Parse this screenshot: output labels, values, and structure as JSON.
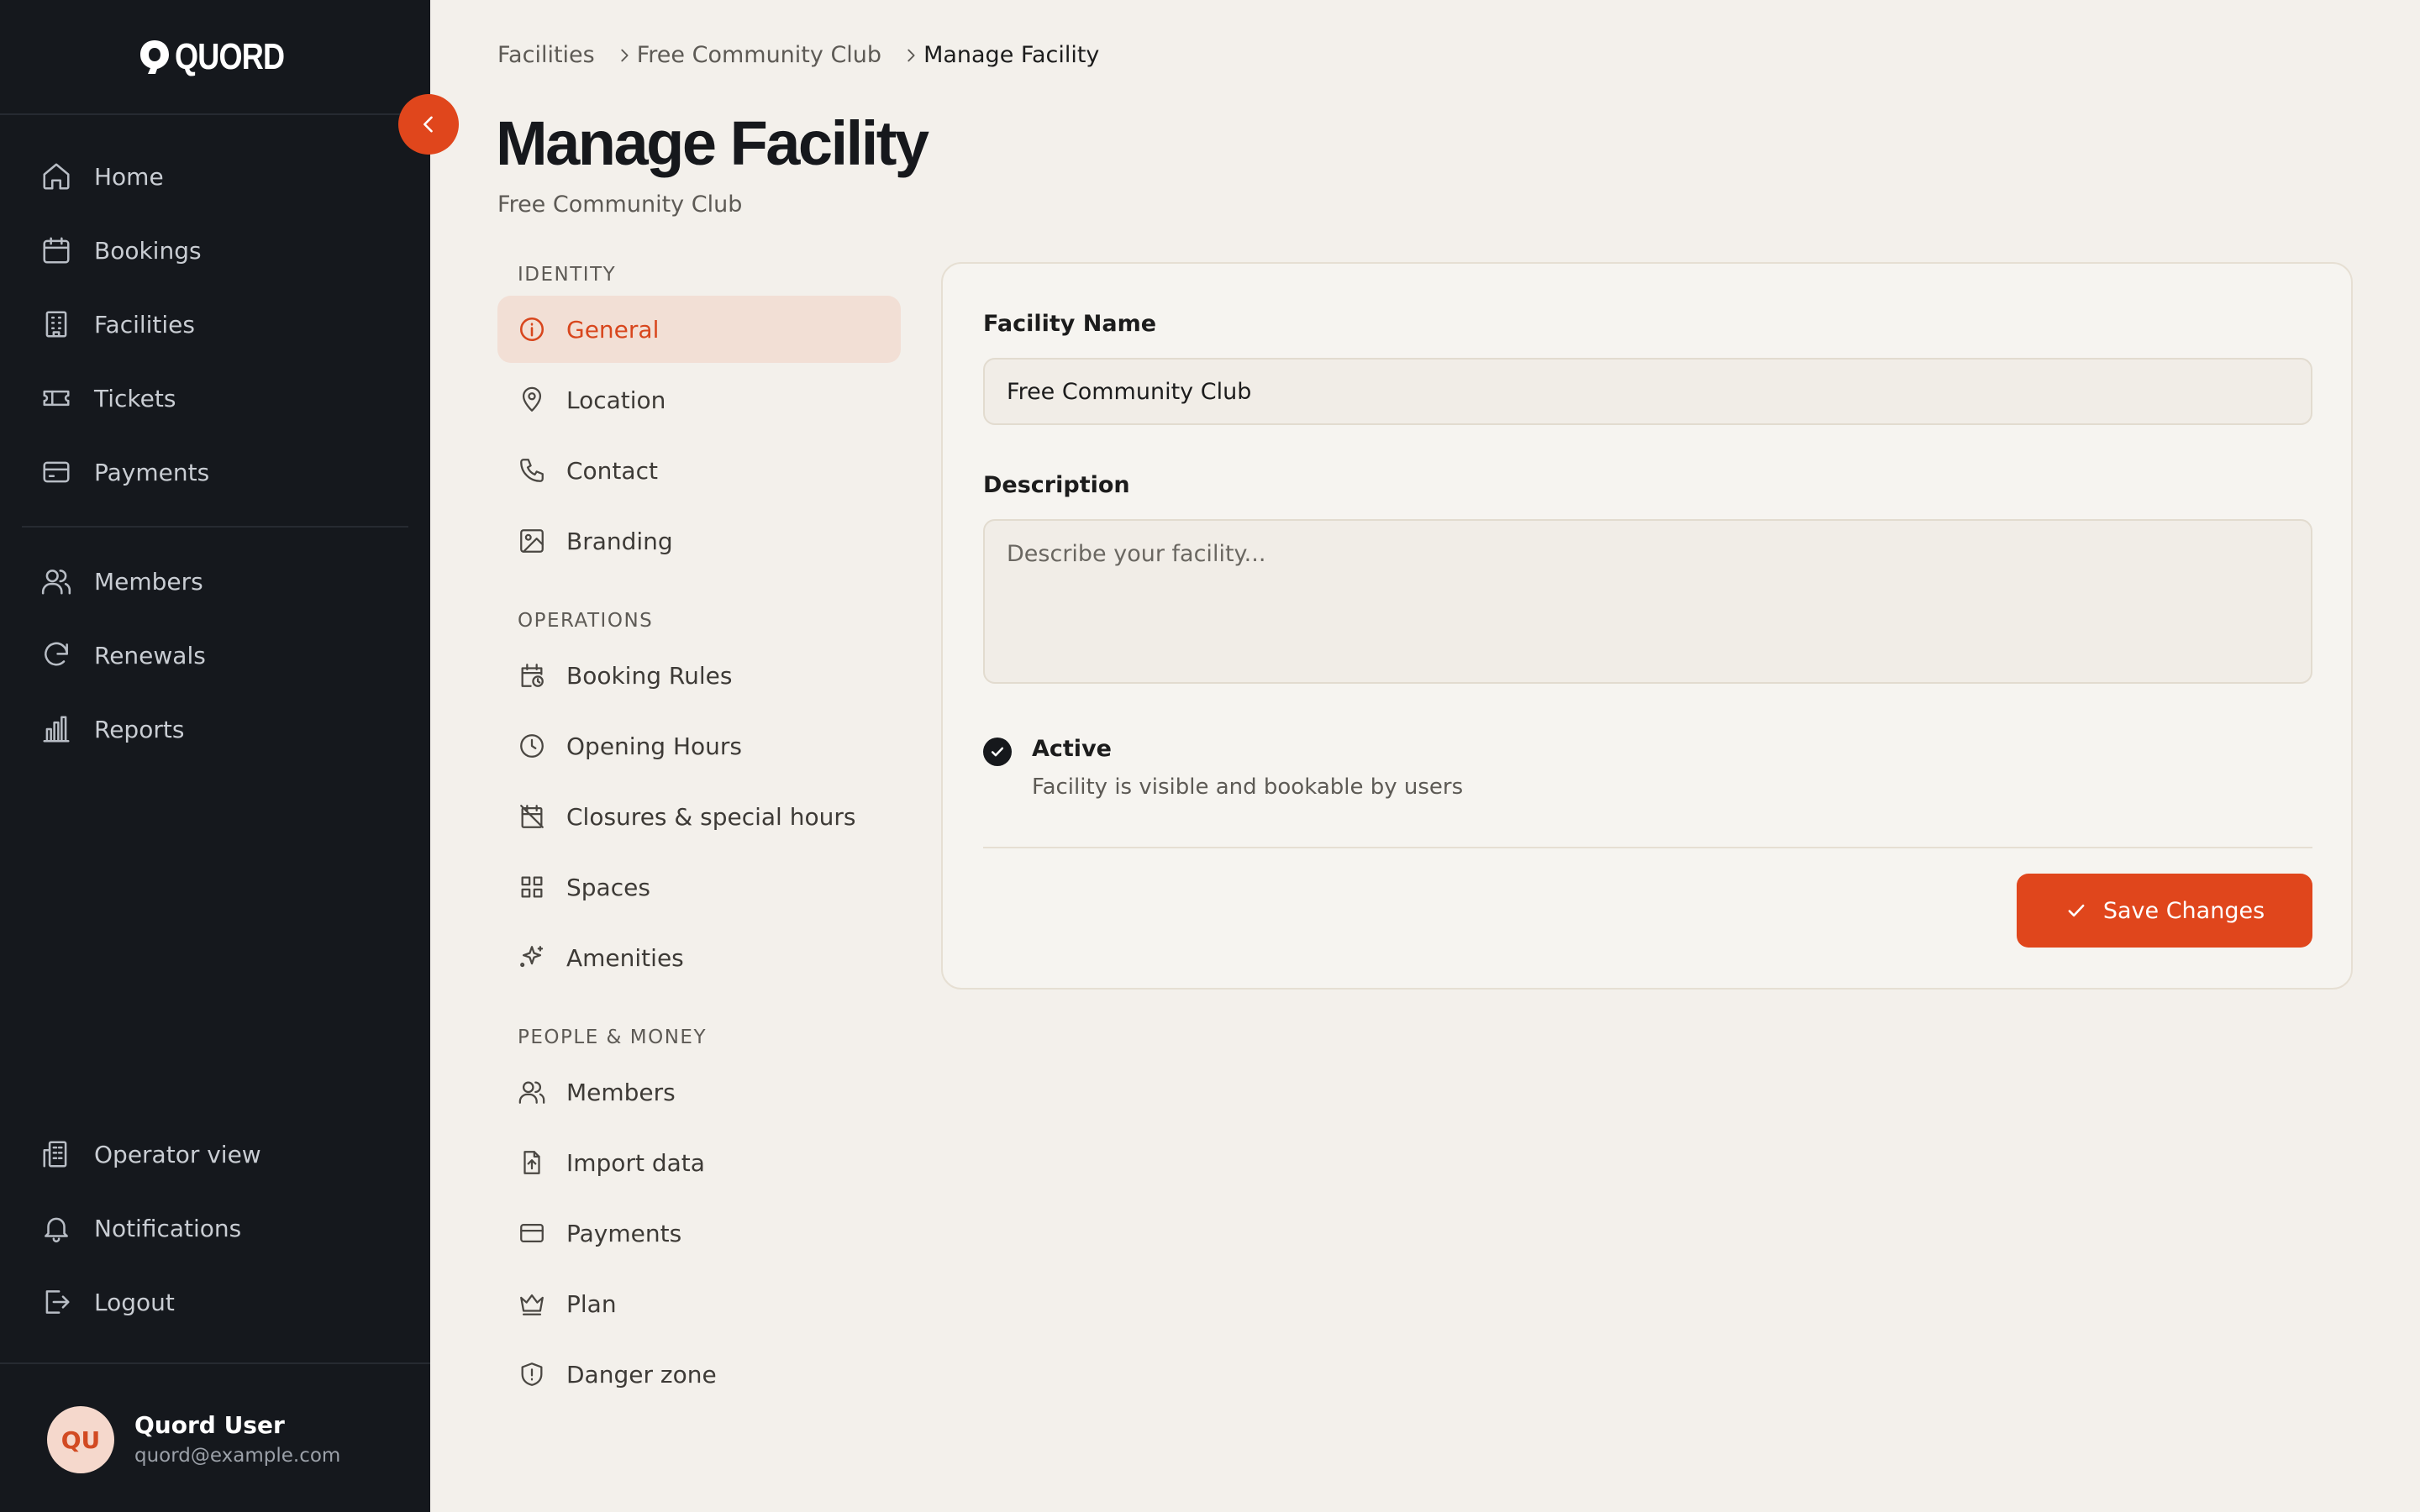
{
  "app": {
    "brand": "QUORD",
    "accent_color": "#e0461c"
  },
  "sidebar": {
    "nav": [
      {
        "label": "Home",
        "icon": "home-icon"
      },
      {
        "label": "Bookings",
        "icon": "calendar-icon"
      },
      {
        "label": "Facilities",
        "icon": "building-icon"
      },
      {
        "label": "Tickets",
        "icon": "ticket-icon"
      },
      {
        "label": "Payments",
        "icon": "credit-card-icon"
      },
      {
        "label": "Members",
        "icon": "users-icon"
      },
      {
        "label": "Renewals",
        "icon": "refresh-icon"
      },
      {
        "label": "Reports",
        "icon": "bar-chart-icon"
      }
    ],
    "bottom": [
      {
        "label": "Operator view",
        "icon": "office-building-icon"
      },
      {
        "label": "Notifications",
        "icon": "bell-icon"
      },
      {
        "label": "Logout",
        "icon": "logout-icon"
      }
    ],
    "user": {
      "initials": "QU",
      "name": "Quord User",
      "email": "quord@example.com"
    }
  },
  "breadcrumb": [
    "Facilities",
    "Free Community Club",
    "Manage Facility"
  ],
  "page": {
    "title": "Manage Facility",
    "subtitle": "Free Community Club"
  },
  "subnav": {
    "sections": [
      {
        "label": "IDENTITY",
        "items": [
          "General",
          "Location",
          "Contact",
          "Branding"
        ]
      },
      {
        "label": "OPERATIONS",
        "items": [
          "Booking Rules",
          "Opening Hours",
          "Closures & special hours",
          "Spaces",
          "Amenities"
        ]
      },
      {
        "label": "PEOPLE & MONEY",
        "items": [
          "Members",
          "Import data",
          "Payments",
          "Plan",
          "Danger zone"
        ]
      }
    ],
    "active": "General"
  },
  "form": {
    "name_label": "Facility Name",
    "name_value": "Free Community Club",
    "description_label": "Description",
    "description_placeholder": "Describe your facility...",
    "description_value": "",
    "active_label": "Active",
    "active_description": "Facility is visible and bookable by users",
    "active_checked": true,
    "save_label": "Save Changes"
  }
}
